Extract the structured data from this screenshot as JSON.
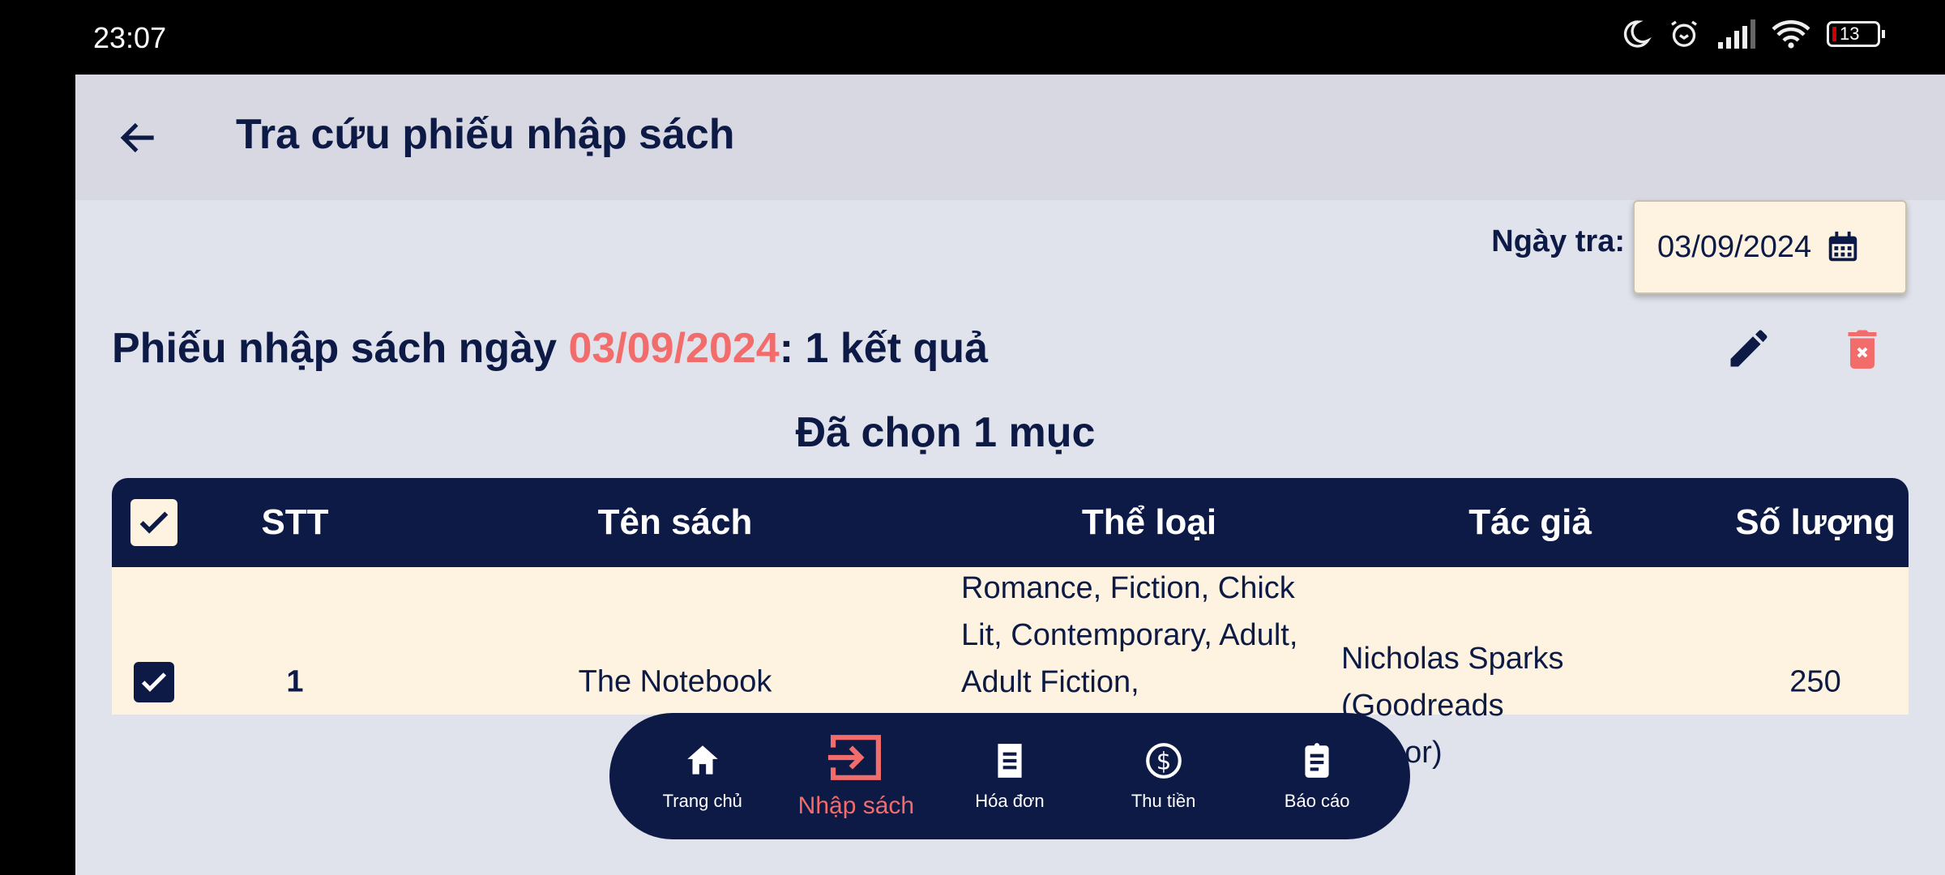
{
  "status": {
    "time": "23:07",
    "battery": "13"
  },
  "appbar": {
    "title": "Tra cứu phiếu nhập sách"
  },
  "filter": {
    "label": "Ngày tra:",
    "date": "03/09/2024"
  },
  "heading": {
    "prefix": "Phiếu nhập sách ngày ",
    "date": "03/09/2024",
    "suffix": ": 1 kết quả"
  },
  "selection": "Đã chọn 1 mục",
  "table": {
    "headers": [
      "STT",
      "Tên sách",
      "Thể loại",
      "Tác giả",
      "Số lượng"
    ],
    "rows": [
      {
        "stt": "1",
        "title": "The Notebook",
        "genre": "Romance, Fiction, Chick Lit, Contemporary, Adult, Adult Fiction,",
        "author": "Nicholas Sparks (Goodreads Author)",
        "qty": "250",
        "checked": true
      }
    ]
  },
  "nav": [
    {
      "label": "Trang chủ",
      "icon": "home-icon"
    },
    {
      "label": "Nhập sách",
      "icon": "input-icon",
      "active": true
    },
    {
      "label": "Hóa đơn",
      "icon": "receipt-icon"
    },
    {
      "label": "Thu tiền",
      "icon": "dollar-icon"
    },
    {
      "label": "Báo cáo",
      "icon": "clipboard-icon"
    }
  ],
  "colors": {
    "primary": "#0d1a45",
    "accent": "#f36c6c",
    "row": "#fdf3e0"
  }
}
